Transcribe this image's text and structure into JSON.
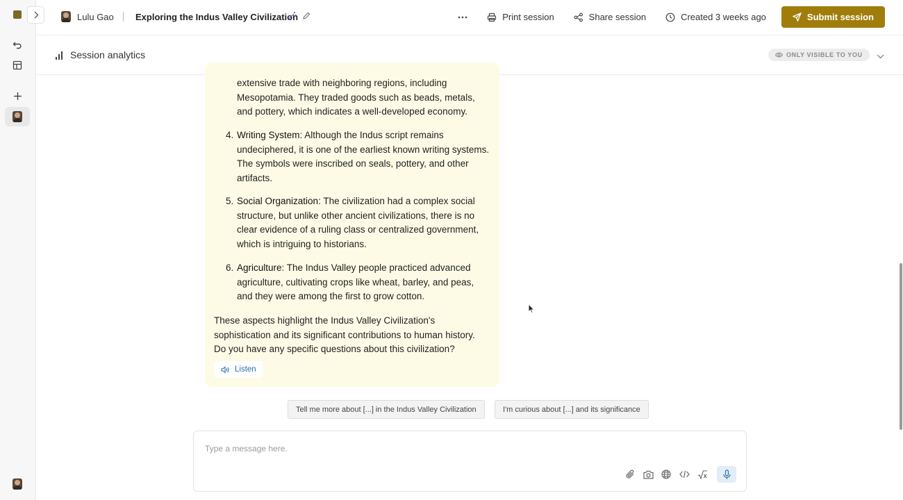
{
  "header": {
    "user_name": "Lulu Gao",
    "session_title": "Exploring the Indus Valley Civilization",
    "more_label": "More options",
    "print_label": "Print session",
    "share_label": "Share session",
    "created_label": "Created 3 weeks ago",
    "submit_label": "Submit session",
    "accent_color": "#a07d0b"
  },
  "analytics": {
    "label": "Session analytics",
    "visibility": "ONLY VISIBLE TO YOU"
  },
  "message": {
    "partial_item": "extensive trade with neighboring regions, including Mesopotamia. They traded goods such as beads, metals, and pottery, which indicates a well-developed economy.",
    "items": [
      {
        "num": "4.",
        "term": "Writing System",
        "text": ": Although the Indus script remains undeciphered, it is one of the earliest known writing systems. The symbols were inscribed on seals, pottery, and other artifacts."
      },
      {
        "num": "5.",
        "term": "Social Organization",
        "text": ": The civilization had a complex social structure, but unlike other ancient civilizations, there is no clear evidence of a ruling class or centralized government, which is intriguing to historians."
      },
      {
        "num": "6.",
        "term": "Agriculture",
        "text": ": The Indus Valley people practiced advanced agriculture, cultivating crops like wheat, barley, and peas, and they were among the first to grow cotton."
      }
    ],
    "closing": "These aspects highlight the Indus Valley Civilization's sophistication and its significant contributions to human history. Do you have any specific questions about this civilization?",
    "listen_label": "Listen",
    "bubble_color": "#fdfbe6"
  },
  "suggestions": [
    "Tell me more about [...] in the Indus Valley Civilization",
    "I'm curious about [...] and its significance"
  ],
  "composer": {
    "placeholder": "Type a message here.",
    "value": ""
  }
}
